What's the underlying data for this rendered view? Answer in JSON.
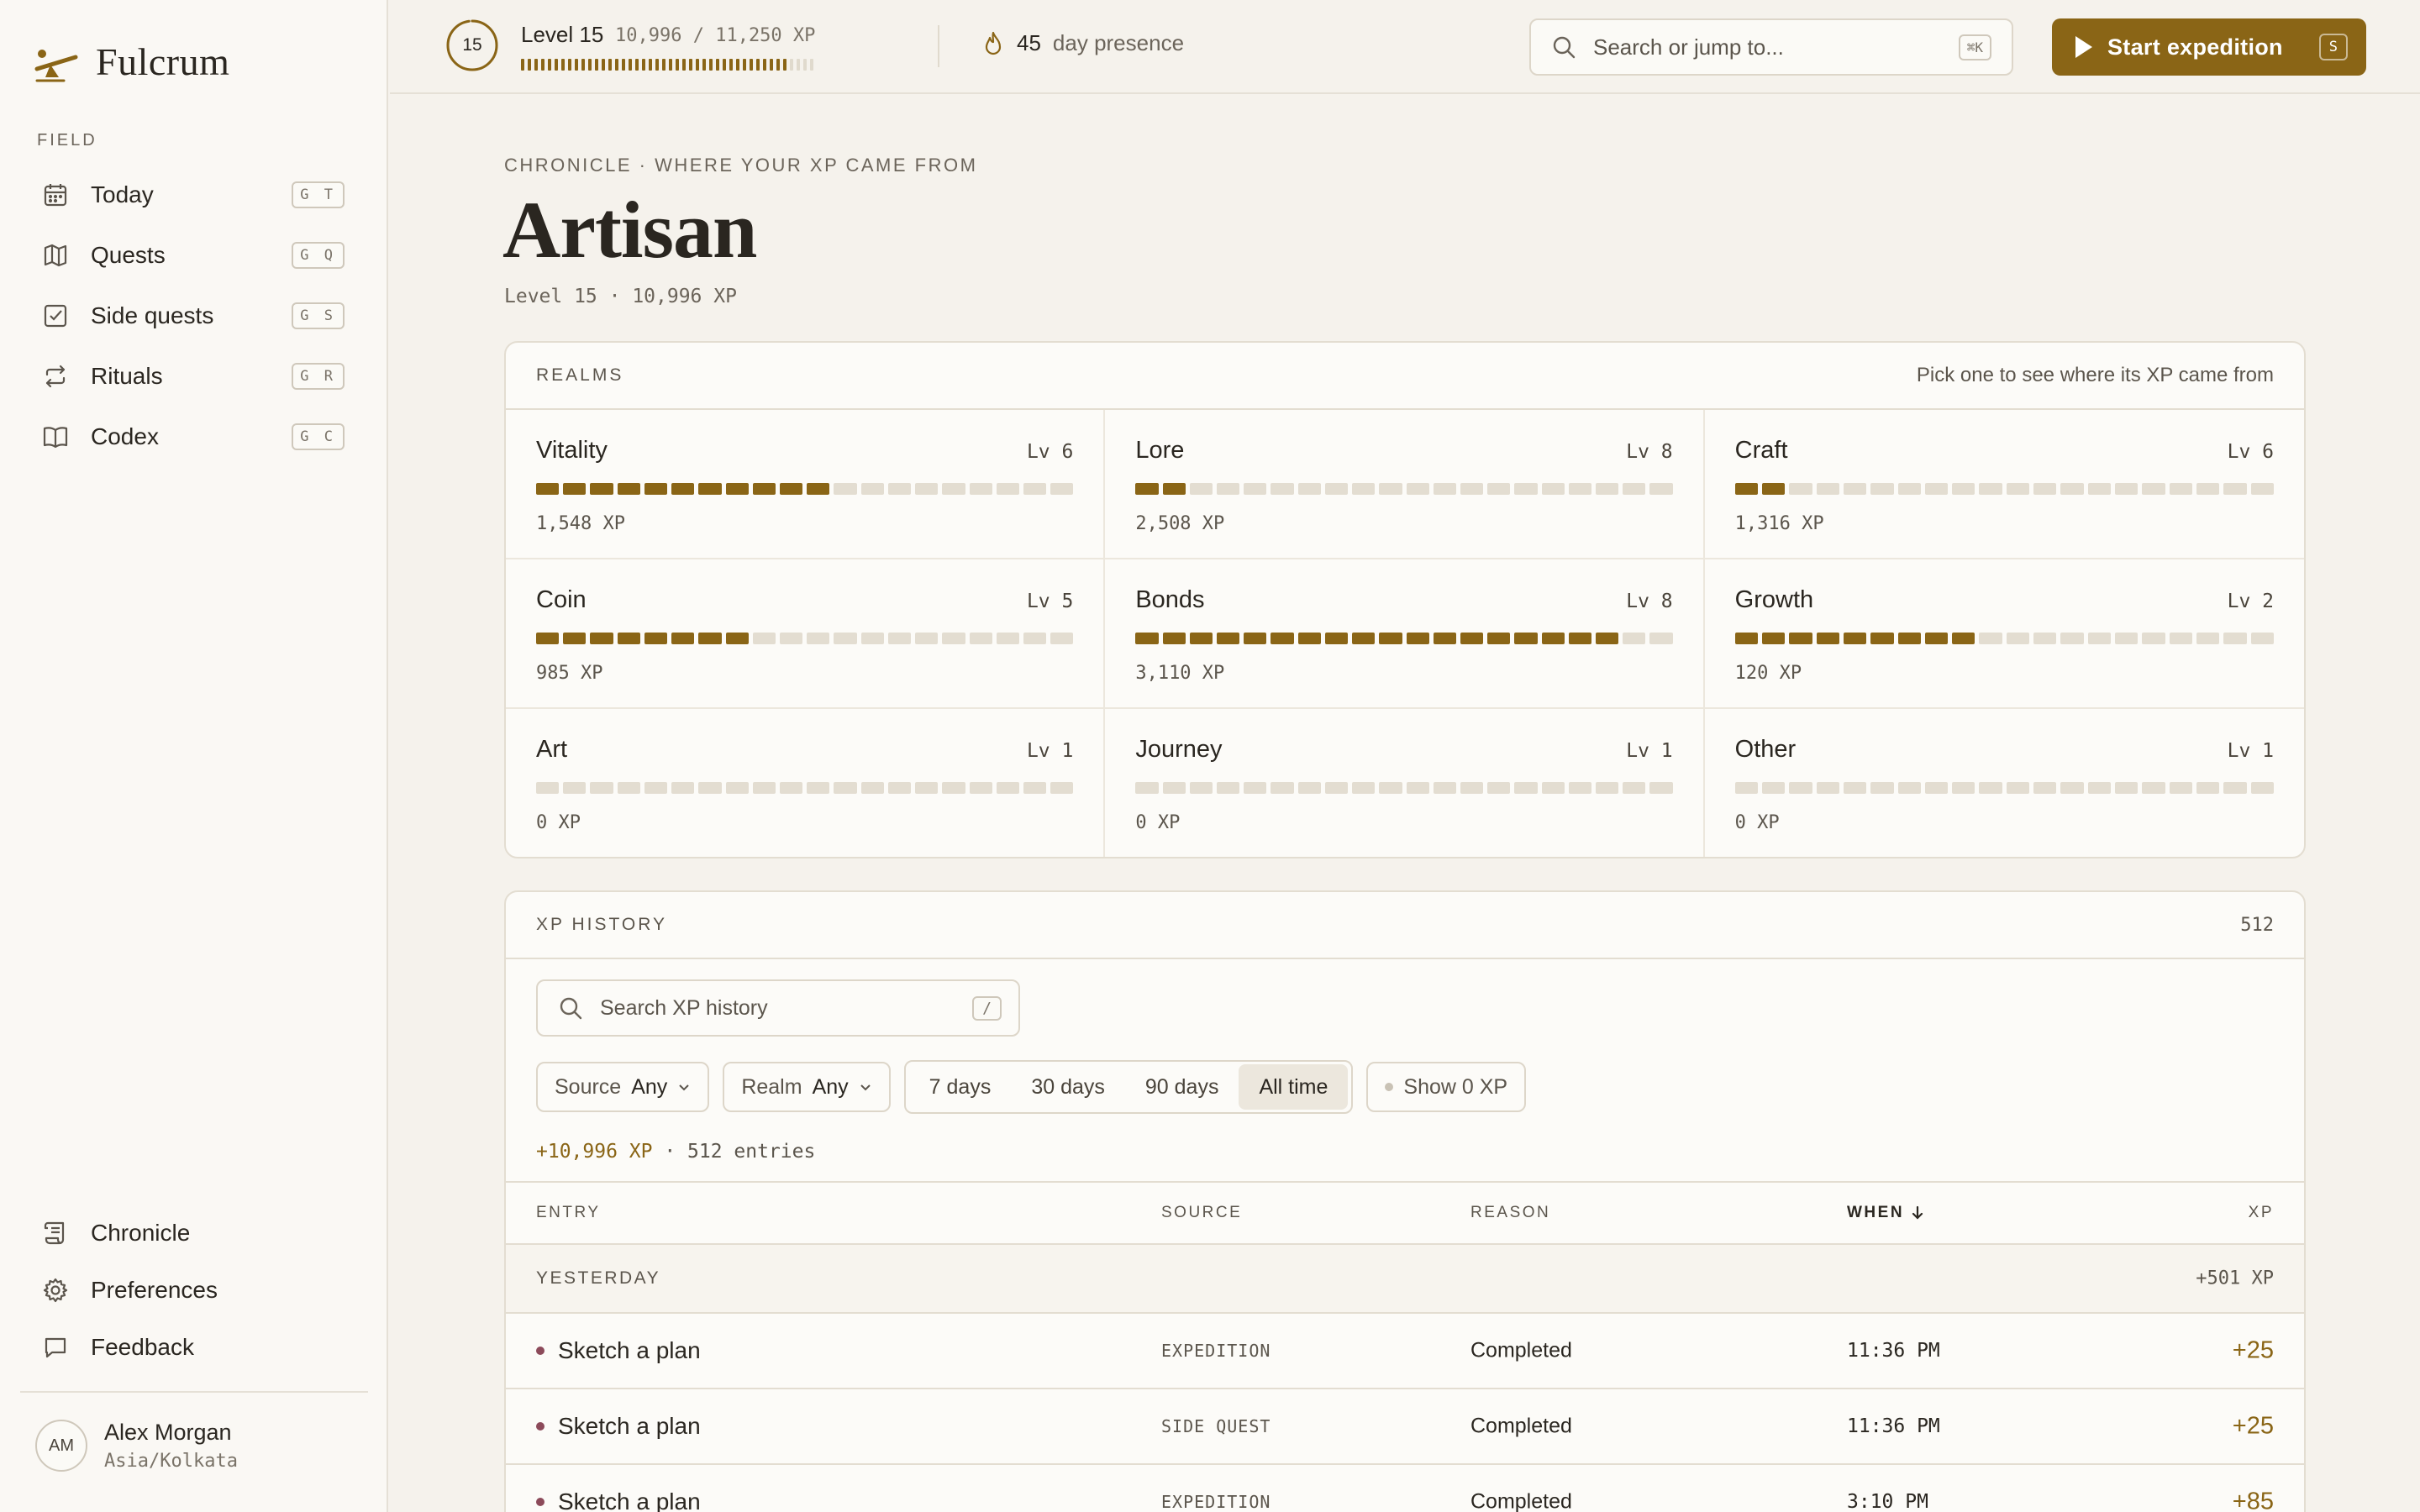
{
  "app": {
    "name": "Fulcrum"
  },
  "sidebar": {
    "section_label": "FIELD",
    "items": [
      {
        "label": "Today",
        "shortcut": "G T",
        "icon": "calendar-icon"
      },
      {
        "label": "Quests",
        "shortcut": "G Q",
        "icon": "map-icon"
      },
      {
        "label": "Side quests",
        "shortcut": "G S",
        "icon": "checkbox-icon"
      },
      {
        "label": "Rituals",
        "shortcut": "G R",
        "icon": "repeat-icon"
      },
      {
        "label": "Codex",
        "shortcut": "G C",
        "icon": "book-icon"
      }
    ],
    "bottom_items": [
      {
        "label": "Chronicle",
        "icon": "scroll-icon"
      },
      {
        "label": "Preferences",
        "icon": "gear-icon"
      },
      {
        "label": "Feedback",
        "icon": "chat-icon"
      }
    ],
    "user": {
      "initials": "AM",
      "name": "Alex Morgan",
      "timezone": "Asia/Kolkata"
    }
  },
  "topbar": {
    "level_number": "15",
    "level_label": "Level 15",
    "xp_text": "10,996 / 11,250 XP",
    "xp_progress": 0.977,
    "streak_count": "45",
    "streak_label": "day presence",
    "search_placeholder": "Search or jump to...",
    "search_shortcut": "⌘K",
    "start_label": "Start expedition",
    "start_shortcut": "S"
  },
  "page": {
    "eyebrow": "CHRONICLE · WHERE YOUR XP CAME FROM",
    "title": "Artisan",
    "subtitle": "Level 15 · 10,996 XP"
  },
  "realms": {
    "title": "REALMS",
    "hint": "Pick one to see where its XP came from",
    "items": [
      {
        "name": "Vitality",
        "level": "Lv 6",
        "xp": "1,548 XP",
        "filled": 11
      },
      {
        "name": "Lore",
        "level": "Lv 8",
        "xp": "2,508 XP",
        "filled": 2
      },
      {
        "name": "Craft",
        "level": "Lv 6",
        "xp": "1,316 XP",
        "filled": 2
      },
      {
        "name": "Coin",
        "level": "Lv 5",
        "xp": "985 XP",
        "filled": 8
      },
      {
        "name": "Bonds",
        "level": "Lv 8",
        "xp": "3,110 XP",
        "filled": 18
      },
      {
        "name": "Growth",
        "level": "Lv 2",
        "xp": "120 XP",
        "filled": 9
      },
      {
        "name": "Art",
        "level": "Lv 1",
        "xp": "0 XP",
        "filled": 0
      },
      {
        "name": "Journey",
        "level": "Lv 1",
        "xp": "0 XP",
        "filled": 0
      },
      {
        "name": "Other",
        "level": "Lv 1",
        "xp": "0 XP",
        "filled": 0
      }
    ]
  },
  "history": {
    "title": "XP HISTORY",
    "count": "512",
    "search_placeholder": "Search XP history",
    "search_shortcut": "/",
    "filters": {
      "source_label": "Source",
      "source_value": "Any",
      "realm_label": "Realm",
      "realm_value": "Any",
      "ranges": [
        "7 days",
        "30 days",
        "90 days",
        "All time"
      ],
      "active_range": "All time",
      "toggle_label": "Show 0 XP"
    },
    "summary_total": "+10,996 XP",
    "summary_entries": " · 512 entries",
    "columns": {
      "entry": "ENTRY",
      "source": "SOURCE",
      "reason": "REASON",
      "when": "WHEN",
      "xp": "XP"
    },
    "group": {
      "label": "YESTERDAY",
      "total": "+501 XP"
    },
    "rows": [
      {
        "entry": "Sketch a plan",
        "source": "EXPEDITION",
        "reason": "Completed",
        "when": "11:36 PM",
        "xp": "+25"
      },
      {
        "entry": "Sketch a plan",
        "source": "SIDE QUEST",
        "reason": "Completed",
        "when": "11:36 PM",
        "xp": "+25"
      },
      {
        "entry": "Sketch a plan",
        "source": "EXPEDITION",
        "reason": "Completed",
        "when": "3:10 PM",
        "xp": "+85"
      }
    ]
  }
}
